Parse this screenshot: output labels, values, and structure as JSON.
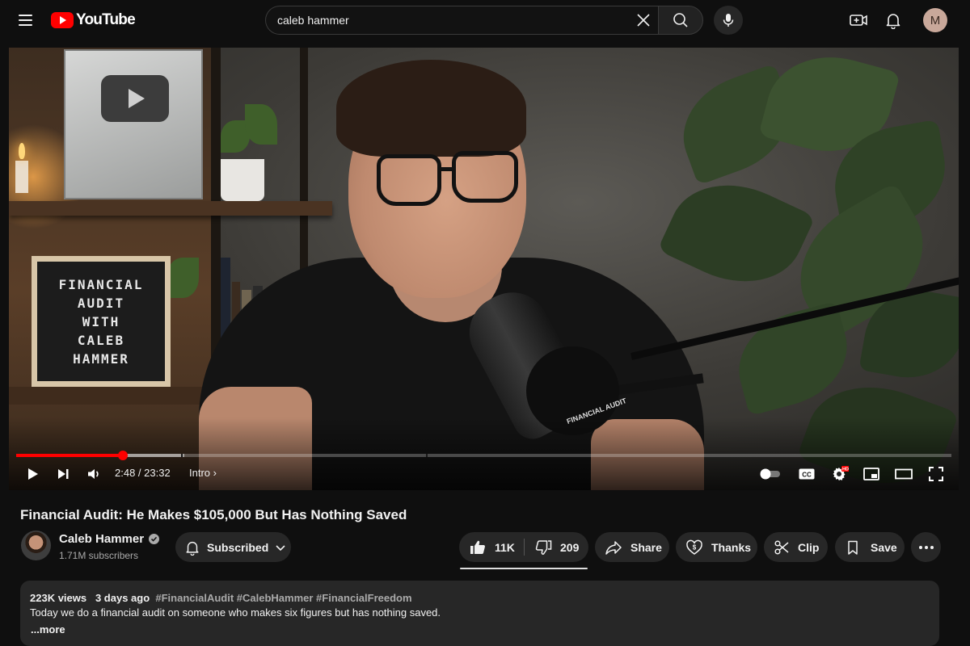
{
  "header": {
    "logo_text": "YouTube",
    "search": {
      "value": "caleb hammer"
    },
    "avatar_letter": "M"
  },
  "player": {
    "board_lines": [
      "FINANCIAL",
      "AUDIT",
      "WITH",
      "CALEB",
      "HAMMER"
    ],
    "mic_label": "FINANCIAL AUDIT",
    "progress": {
      "played_fraction": 0.114,
      "buffered_fraction": 0.18,
      "chapter_marks": [
        0.176,
        0.438
      ]
    },
    "time_display": "2:48 / 23:32",
    "chapter_label": "Intro",
    "hd_badge": "HD",
    "cc_label": "CC",
    "settings_badge": "HD"
  },
  "video": {
    "title": "Financial Audit: He Makes $105,000 But Has Nothing Saved",
    "channel": {
      "name": "Caleb Hammer",
      "subscribers": "1.71M subscribers"
    },
    "actions": {
      "subscribe_label": "Subscribed",
      "like_count": "11K",
      "dislike_count": "209",
      "share_label": "Share",
      "thanks_label": "Thanks",
      "clip_label": "Clip",
      "save_label": "Save"
    }
  },
  "description": {
    "views": "223K views",
    "age": "3 days ago",
    "hashtags": "#FinancialAudit #CalebHammer #FinancialFreedom",
    "text": "Today we do a financial audit on someone who makes six figures but has nothing saved.",
    "more_label": "...more"
  },
  "colors": {
    "background": "#0f0f0f",
    "brand_red": "#ff0000",
    "button_bg": "#272727",
    "secondary_text": "#aaaaaa"
  }
}
